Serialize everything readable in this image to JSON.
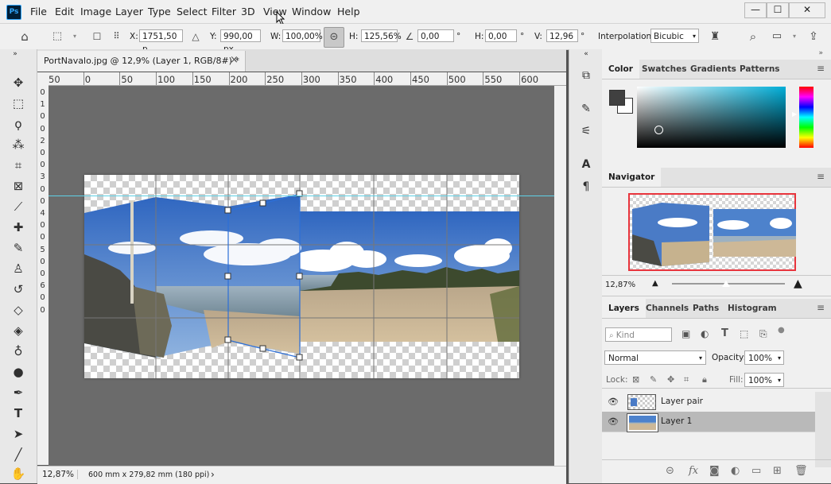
{
  "app": {
    "logo": "Ps"
  },
  "menu": [
    "File",
    "Edit",
    "Image",
    "Layer",
    "Type",
    "Select",
    "Filter",
    "3D",
    "View",
    "Window",
    "Help"
  ],
  "window_controls": {
    "minimize": "—",
    "maximize": "☐",
    "close": "✕"
  },
  "options": {
    "x_label": "X:",
    "x_value": "1751,50 p",
    "y_label": "Y:",
    "y_value": "990,00 px",
    "w_label": "W:",
    "w_value": "100,00%",
    "h_label": "H:",
    "h_value": "125,56%",
    "angle_value": "0,00",
    "hskew_label": "H:",
    "hskew_value": "0,00",
    "vskew_label": "V:",
    "vskew_value": "12,96",
    "degree": "°",
    "interp_label": "Interpolation:",
    "interp_value": "Bicubic"
  },
  "document": {
    "tab_title": "PortNavalo.jpg @ 12,9% (Layer 1, RGB/8#) *",
    "tab_close": "×",
    "ruler_h": [
      "50",
      "0",
      "50",
      "100",
      "150",
      "200",
      "250",
      "300",
      "350",
      "400",
      "450",
      "500",
      "550",
      "600"
    ],
    "ruler_v": [
      "0",
      "1",
      "0",
      "0",
      "2",
      "0",
      "0",
      "3",
      "0",
      "0",
      "4",
      "0",
      "0",
      "5",
      "0",
      "0",
      "6",
      "0",
      "0"
    ]
  },
  "status": {
    "zoom": "12,87%",
    "doc_info": "600 mm x 279,82 mm (180 ppi)",
    "arrow": "›"
  },
  "color_panel": {
    "tabs": [
      "Color",
      "Swatches",
      "Gradients",
      "Patterns"
    ],
    "foreground": "#404040",
    "background": "#ffffff",
    "field_hue": "#00aed8"
  },
  "navigator": {
    "title": "Navigator",
    "zoom": "12,87%",
    "view_box_color": "#e8343c",
    "zoom_slider": 0.48
  },
  "layers_panel": {
    "tabs": [
      "Layers",
      "Channels",
      "Paths",
      "Histogram"
    ],
    "kind_placeholder": "Kind",
    "blend_mode": "Normal",
    "opacity_label": "Opacity:",
    "opacity_value": "100%",
    "lock_label": "Lock:",
    "fill_label": "Fill:",
    "fill_value": "100%",
    "layers": [
      {
        "name": "Layer pair",
        "visible": true,
        "selected": false
      },
      {
        "name": "Layer 1",
        "visible": true,
        "selected": true
      }
    ]
  },
  "colors": {
    "guide": "#5ed0e6",
    "transform_box": "#2c6fd8",
    "sky": "#3a72c4",
    "sand": "#c9b48d"
  }
}
